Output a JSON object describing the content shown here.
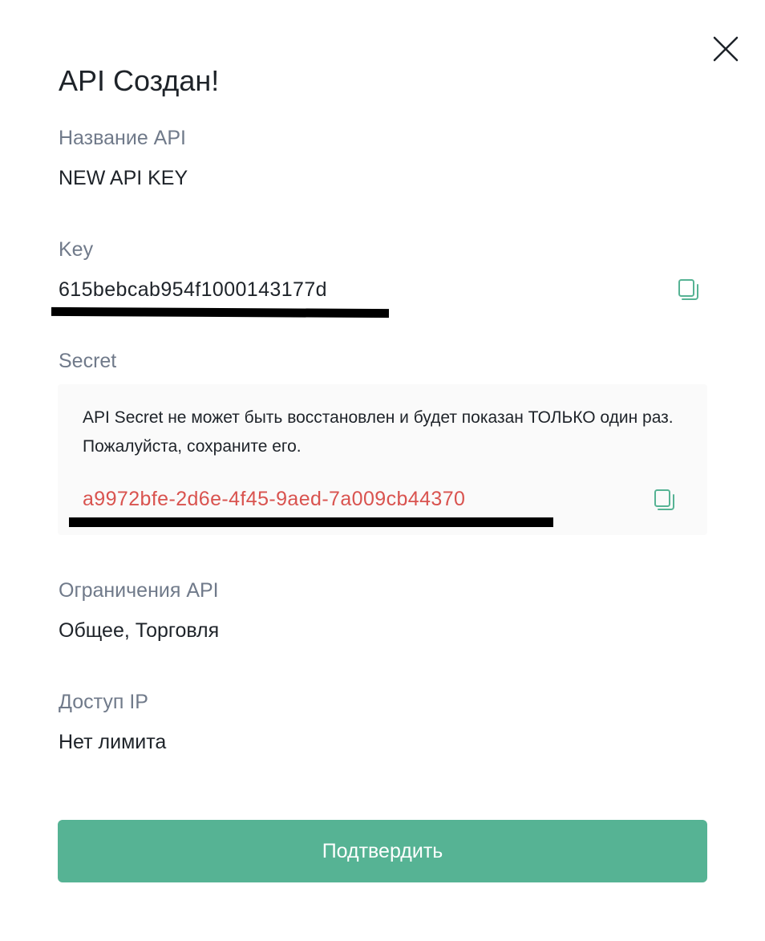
{
  "modal": {
    "title": "API Создан!",
    "close_icon": "close-icon"
  },
  "api_name": {
    "label": "Название API",
    "value": "NEW API KEY"
  },
  "key": {
    "label": "Key",
    "value": "615bebcab954f1000143177d",
    "copy_icon": "copy-icon"
  },
  "secret": {
    "label": "Secret",
    "warning": "API Secret не может быть восстановлен и будет показан ТОЛЬКО один раз. Пожалуйста, сохраните его.",
    "value": "a9972bfe-2d6e-4f45-9aed-7a009cb44370",
    "copy_icon": "copy-icon"
  },
  "restrictions": {
    "label": "Ограничения API",
    "value": "Общее, Торговля"
  },
  "ip_access": {
    "label": "Доступ IP",
    "value": "Нет лимита"
  },
  "confirm_button": {
    "label": "Подтвердить"
  },
  "colors": {
    "accent": "#56b394",
    "secret_text": "#d9534f",
    "label_text": "#707a8a",
    "primary_text": "#1e2329",
    "secret_box_bg": "#fafafa"
  }
}
